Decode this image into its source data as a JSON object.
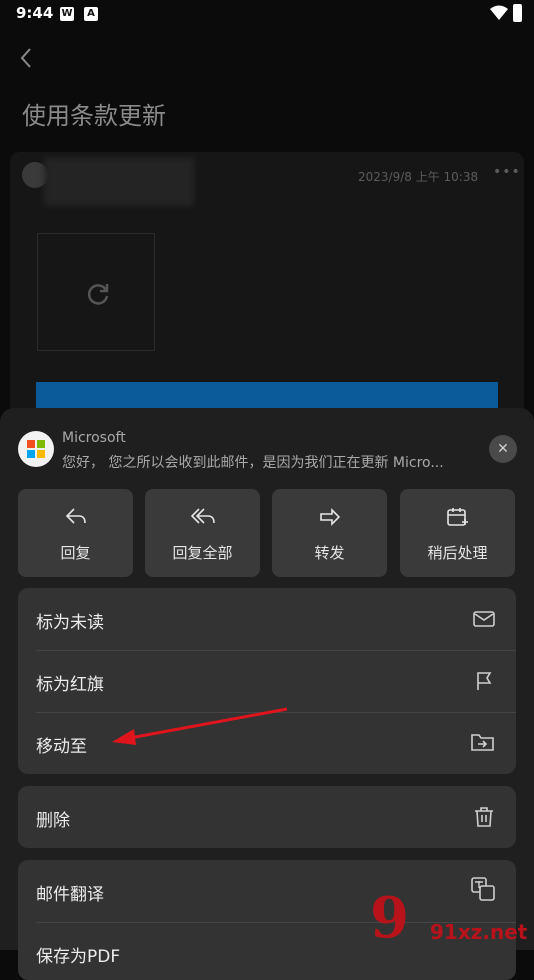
{
  "status_bar": {
    "time": "9:44",
    "icon1": "W",
    "icon2": "A"
  },
  "header": {
    "title": "使用条款更新"
  },
  "email": {
    "date": "2023/9/8 上午 10:38",
    "more": "•••"
  },
  "sheet": {
    "sender": "Microsoft",
    "preview": "您好， 您之所以会收到此邮件，是因为我们正在更新 Micro...",
    "close": "✕",
    "actions": [
      {
        "label": "回复",
        "icon": "reply-icon"
      },
      {
        "label": "回复全部",
        "icon": "reply-all-icon"
      },
      {
        "label": "转发",
        "icon": "forward-icon"
      },
      {
        "label": "稍后处理",
        "icon": "snooze-icon"
      }
    ],
    "menu": [
      {
        "label": "标为未读",
        "icon": "envelope-icon"
      },
      {
        "label": "标为红旗",
        "icon": "flag-icon"
      },
      {
        "label": "移动至",
        "icon": "move-folder-icon"
      }
    ],
    "delete": {
      "label": "删除",
      "icon": "trash-icon"
    },
    "more_menu": [
      {
        "label": "邮件翻译",
        "icon": "translate-icon"
      },
      {
        "label": "保存为PDF",
        "icon": "pdf-icon"
      }
    ]
  },
  "watermark": {
    "mark": "9",
    "text": "91xz.net"
  },
  "colors": {
    "accent_blue": "#0b5a9a",
    "annotation_red": "#e0141c",
    "ms_red": "#f25022",
    "ms_green": "#7fba00",
    "ms_blue": "#00a4ef",
    "ms_yellow": "#ffb900"
  }
}
